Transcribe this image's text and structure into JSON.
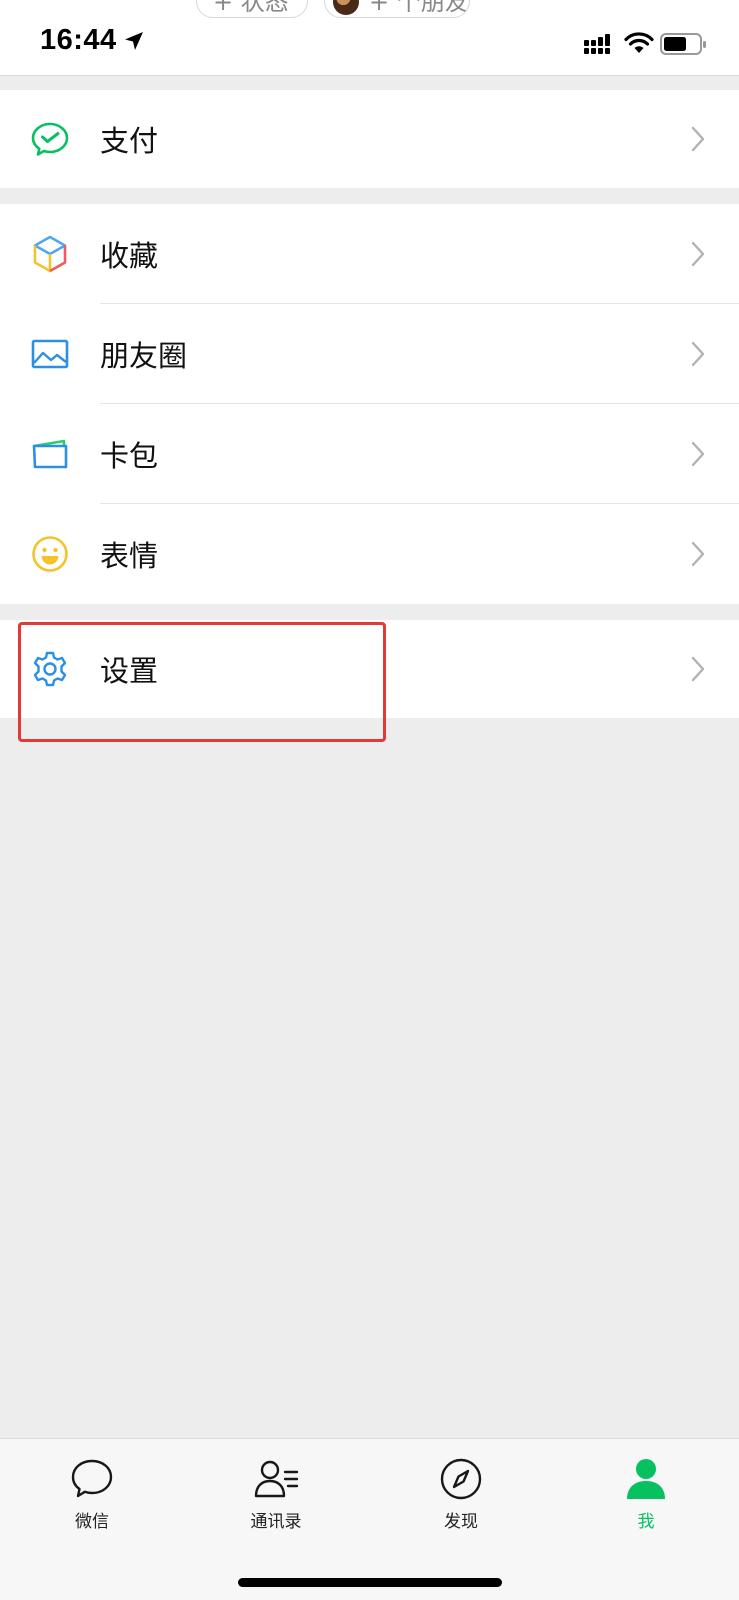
{
  "status_bar": {
    "time": "16:44",
    "top_pills": {
      "status": "+ 状态",
      "friends": "+ 个朋友"
    }
  },
  "menu": {
    "pay": {
      "label": "支付",
      "icon": "wechat-pay-icon"
    },
    "items": [
      {
        "label": "收藏",
        "icon": "favorites-cube-icon"
      },
      {
        "label": "朋友圈",
        "icon": "moments-picture-icon"
      },
      {
        "label": "卡包",
        "icon": "card-wallet-icon"
      },
      {
        "label": "表情",
        "icon": "smiley-icon"
      }
    ],
    "settings": {
      "label": "设置",
      "icon": "gear-icon"
    }
  },
  "tab_bar": {
    "tabs": [
      {
        "label": "微信",
        "icon": "chat-bubble-icon",
        "active": false
      },
      {
        "label": "通讯录",
        "icon": "contacts-icon",
        "active": false
      },
      {
        "label": "发现",
        "icon": "compass-icon",
        "active": false
      },
      {
        "label": "我",
        "icon": "person-icon",
        "active": true
      }
    ]
  },
  "colors": {
    "accent_green": "#07C160",
    "background": "#EDEDED",
    "highlight_red": "#E53935"
  }
}
